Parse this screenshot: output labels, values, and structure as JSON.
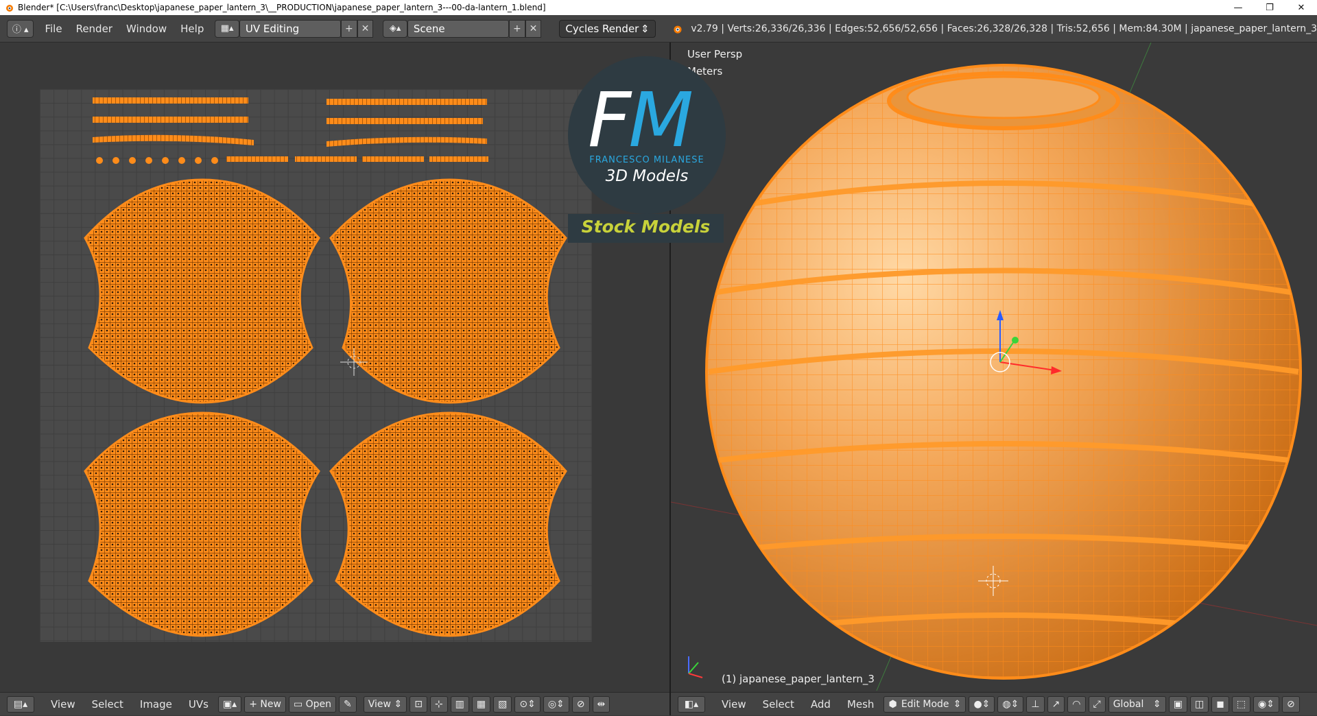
{
  "window": {
    "title": "Blender* [C:\\Users\\franc\\Desktop\\japanese_paper_lantern_3\\__PRODUCTION\\japanese_paper_lantern_3---00-da-lantern_1.blend]",
    "minimize": "—",
    "restore": "❐",
    "close": "✕"
  },
  "info_header": {
    "menus": [
      "File",
      "Render",
      "Window",
      "Help"
    ],
    "screen_layout": "UV Editing",
    "scene": "Scene",
    "render_engine": "Cycles Render",
    "stats": "v2.79 | Verts:26,336/26,336 | Edges:52,656/52,656 | Faces:26,328/26,328 | Tris:52,656 | Mem:84.30M | japanese_paper_lantern_3"
  },
  "watermark": {
    "monogram_f": "F",
    "monogram_m": "M",
    "name": "FRANCESCO MILANESE",
    "subtitle": "3D Models",
    "badge": "Stock Models"
  },
  "viewport": {
    "view_name": "User Persp",
    "units": "Meters",
    "object_label": "(1) japanese_paper_lantern_3"
  },
  "uv_editor_footer": {
    "menus": [
      "View",
      "Select",
      "Image",
      "UVs"
    ],
    "new_label": "New",
    "open_label": "Open",
    "view_label": "View"
  },
  "viewport_footer": {
    "menus": [
      "View",
      "Select",
      "Add",
      "Mesh"
    ],
    "mode": "Edit Mode",
    "orientation": "Global"
  },
  "colors": {
    "mesh_orange": "#ff8c1a",
    "wire_dark": "#d96f00",
    "background": "#393939"
  }
}
